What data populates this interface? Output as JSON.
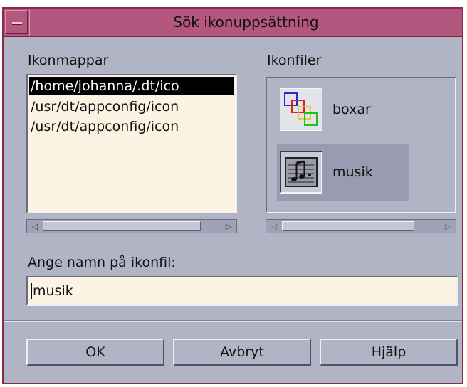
{
  "window": {
    "title": "Sök ikonuppsättning"
  },
  "folders": {
    "label": "Ikonmappar",
    "items": [
      {
        "text": "/home/johanna/.dt/ico",
        "selected": true
      },
      {
        "text": "/usr/dt/appconfig/icon",
        "selected": false
      },
      {
        "text": "/usr/dt/appconfig/icon",
        "selected": false
      }
    ]
  },
  "files": {
    "label": "Ikonfiler",
    "items": [
      {
        "name": "boxar",
        "icon": "boxes-icon",
        "selected": false
      },
      {
        "name": "musik",
        "icon": "music-note-icon",
        "selected": true
      }
    ]
  },
  "filename": {
    "label": "Ange namn på ikonfil:",
    "value": "musik"
  },
  "buttons": {
    "ok": "OK",
    "cancel": "Avbryt",
    "help": "Hjälp"
  },
  "colors": {
    "titlebar": "#b4577f",
    "window_bg": "#b1b4c4",
    "field_bg": "#fdf3e3"
  }
}
